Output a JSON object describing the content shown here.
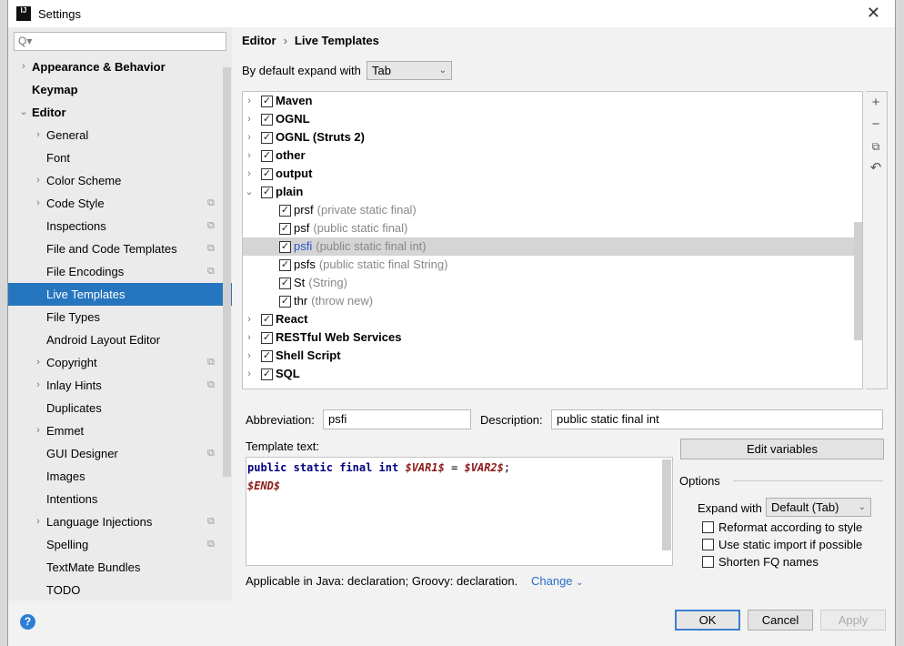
{
  "window": {
    "title": "Settings",
    "logo": "IJ"
  },
  "search": {
    "placeholder": "Q▾"
  },
  "sidebar": {
    "items": [
      {
        "label": "Appearance & Behavior",
        "bold": true,
        "arrow": "›",
        "level": 0
      },
      {
        "label": "Keymap",
        "bold": true,
        "arrow": "",
        "level": 0
      },
      {
        "label": "Editor",
        "bold": true,
        "arrow": "⌄",
        "level": 0
      },
      {
        "label": "General",
        "arrow": "›",
        "level": 1
      },
      {
        "label": "Font",
        "arrow": "",
        "level": 1
      },
      {
        "label": "Color Scheme",
        "arrow": "›",
        "level": 1
      },
      {
        "label": "Code Style",
        "arrow": "›",
        "level": 1,
        "copy": true
      },
      {
        "label": "Inspections",
        "arrow": "",
        "level": 1,
        "copy": true
      },
      {
        "label": "File and Code Templates",
        "arrow": "",
        "level": 1,
        "copy": true
      },
      {
        "label": "File Encodings",
        "arrow": "",
        "level": 1,
        "copy": true
      },
      {
        "label": "Live Templates",
        "arrow": "",
        "level": 1,
        "selected": true
      },
      {
        "label": "File Types",
        "arrow": "",
        "level": 1
      },
      {
        "label": "Android Layout Editor",
        "arrow": "",
        "level": 1
      },
      {
        "label": "Copyright",
        "arrow": "›",
        "level": 1,
        "copy": true
      },
      {
        "label": "Inlay Hints",
        "arrow": "›",
        "level": 1,
        "copy": true
      },
      {
        "label": "Duplicates",
        "arrow": "",
        "level": 1
      },
      {
        "label": "Emmet",
        "arrow": "›",
        "level": 1
      },
      {
        "label": "GUI Designer",
        "arrow": "",
        "level": 1,
        "copy": true
      },
      {
        "label": "Images",
        "arrow": "",
        "level": 1
      },
      {
        "label": "Intentions",
        "arrow": "",
        "level": 1
      },
      {
        "label": "Language Injections",
        "arrow": "›",
        "level": 1,
        "copy": true
      },
      {
        "label": "Spelling",
        "arrow": "",
        "level": 1,
        "copy": true
      },
      {
        "label": "TextMate Bundles",
        "arrow": "",
        "level": 1
      },
      {
        "label": "TODO",
        "arrow": "",
        "level": 1
      }
    ]
  },
  "breadcrumb": {
    "parent": "Editor",
    "sep": "›",
    "current": "Live Templates"
  },
  "expand": {
    "label": "By default expand with",
    "value": "Tab"
  },
  "tree": {
    "rows": [
      {
        "name": "Maven",
        "group": true,
        "arrow": "›"
      },
      {
        "name": "OGNL",
        "group": true,
        "arrow": "›"
      },
      {
        "name": "OGNL (Struts 2)",
        "group": true,
        "arrow": "›"
      },
      {
        "name": "other",
        "group": true,
        "arrow": "›"
      },
      {
        "name": "output",
        "group": true,
        "arrow": "›"
      },
      {
        "name": "plain",
        "group": true,
        "arrow": "⌄"
      },
      {
        "name": "prsf",
        "desc": "(private static final)"
      },
      {
        "name": "psf",
        "desc": "(public static final)"
      },
      {
        "name": "psfi",
        "desc": "(public static final int)",
        "selected": true
      },
      {
        "name": "psfs",
        "desc": "(public static final String)"
      },
      {
        "name": "St",
        "desc": "(String)"
      },
      {
        "name": "thr",
        "desc": "(throw new)"
      },
      {
        "name": "React",
        "group": true,
        "arrow": "›"
      },
      {
        "name": "RESTful Web Services",
        "group": true,
        "arrow": "›"
      },
      {
        "name": "Shell Script",
        "group": true,
        "arrow": "›"
      },
      {
        "name": "SQL",
        "group": true,
        "arrow": "›"
      }
    ]
  },
  "toolbar": {
    "add": "+",
    "remove": "−",
    "copy": "⧉",
    "restore": "↶"
  },
  "form": {
    "abbreviation_label": "Abbreviation:",
    "abbreviation": "psfi",
    "description_label": "Description:",
    "description": "public static final int",
    "template_label": "Template text:",
    "code_line1": {
      "k1": "public",
      "k2": "static",
      "k3": "final",
      "k4": "int",
      "v1": "$VAR1$",
      "eq": "=",
      "v2": "$VAR2$",
      "semi": ";"
    },
    "code_line2": "$END$",
    "edit_variables": "Edit variables",
    "options_label": "Options",
    "expand_with_label": "Expand with",
    "expand_with_value": "Default (Tab)",
    "reformat": "Reformat according to style",
    "static_import": "Use static import if possible",
    "shorten_fq": "Shorten FQ names",
    "applicable": "Applicable in Java: declaration; Groovy: declaration.",
    "change": "Change"
  },
  "buttons": {
    "help": "?",
    "ok": "OK",
    "cancel": "Cancel",
    "apply": "Apply"
  },
  "colors": {
    "selection": "#2675bf",
    "link": "#2a6fc9"
  }
}
